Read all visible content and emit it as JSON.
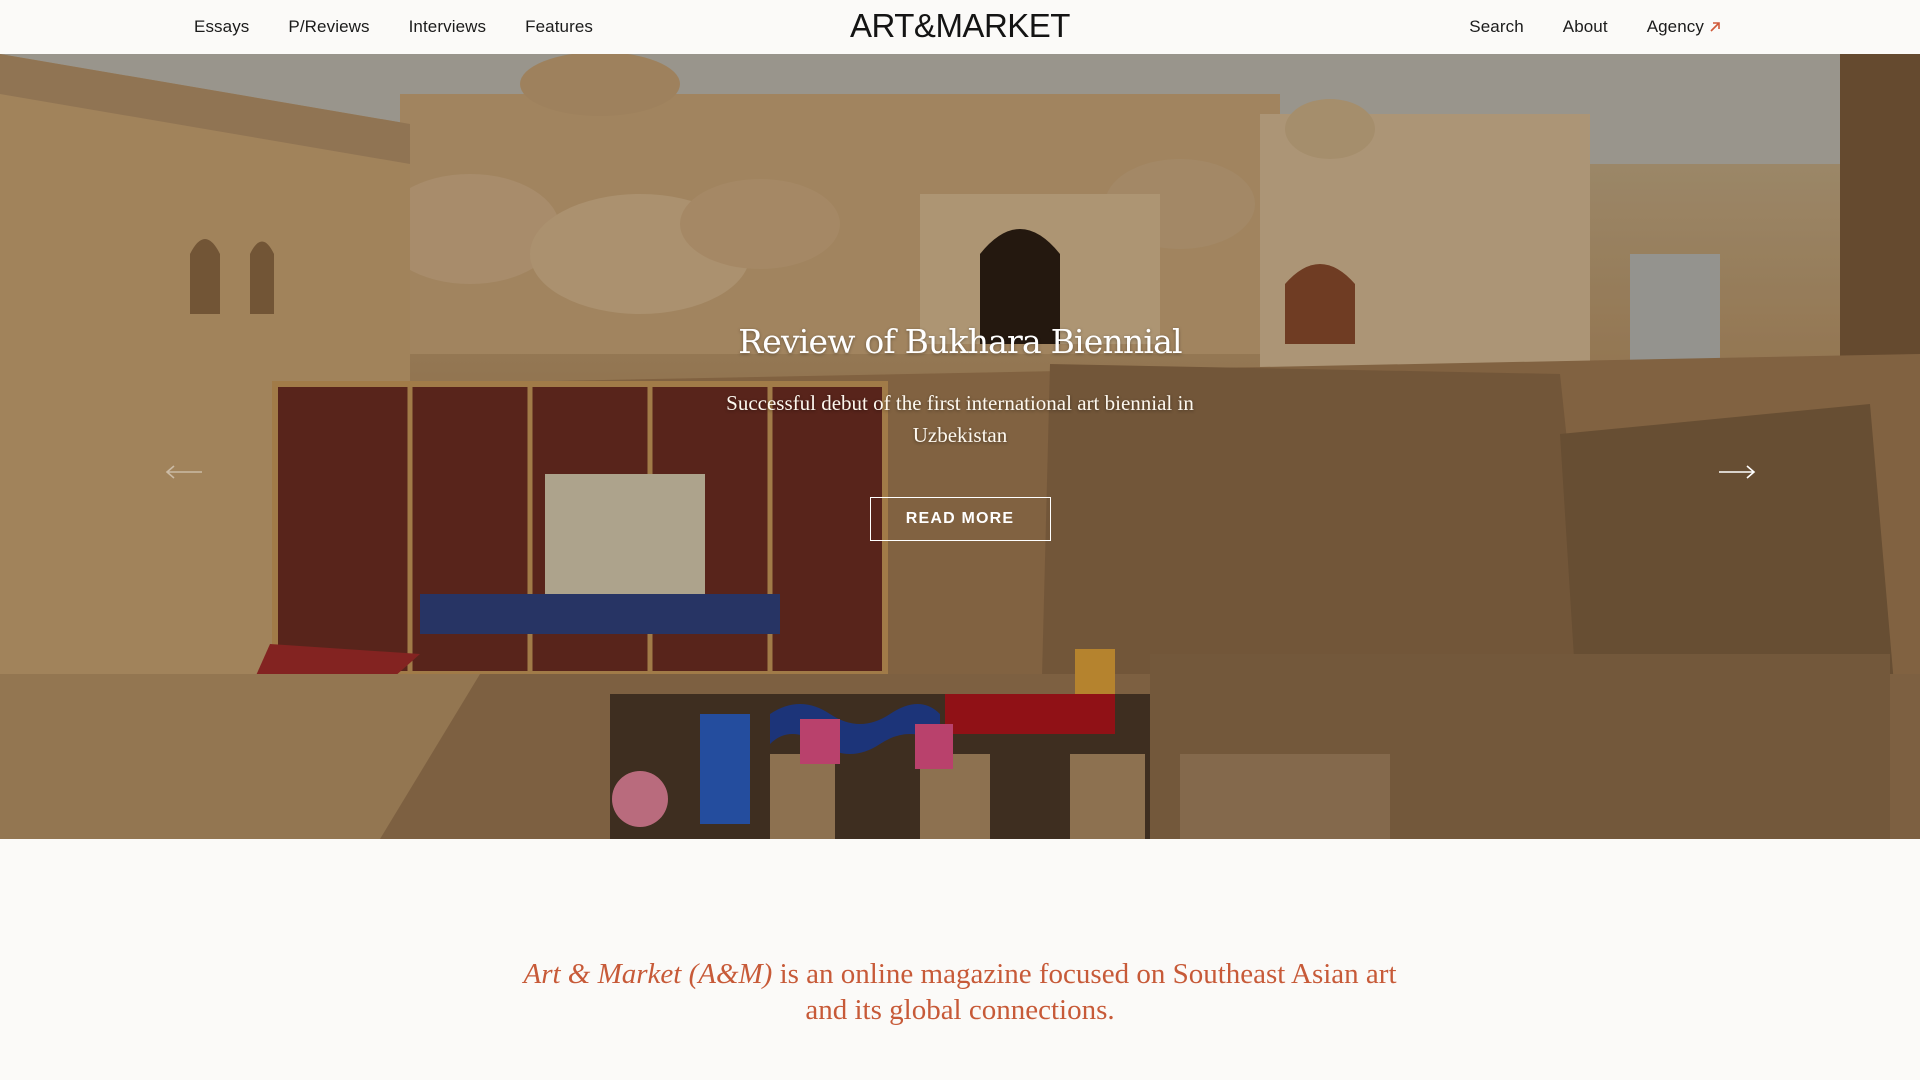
{
  "header": {
    "nav_left": [
      "Essays",
      "P/Reviews",
      "Interviews",
      "Features"
    ],
    "logo": "ART&MARKET",
    "nav_right": [
      "Search",
      "About",
      "Agency"
    ]
  },
  "hero": {
    "title": "Review of Bukhara Biennial",
    "subtitle": "Successful debut of the first international art biennial in Uzbekistan",
    "cta_label": "READ MORE",
    "prev_icon": "arrow-left-icon",
    "next_icon": "arrow-right-icon"
  },
  "intro": {
    "brand_italic": "Art & Market (A&M)",
    "rest": " is an online magazine focused on Southeast Asian art and its global connections."
  },
  "colors": {
    "accent": "#c75a38",
    "agency_arrow": "#d05a3a",
    "background": "#fbfaf8",
    "text": "#1b1b1b"
  }
}
